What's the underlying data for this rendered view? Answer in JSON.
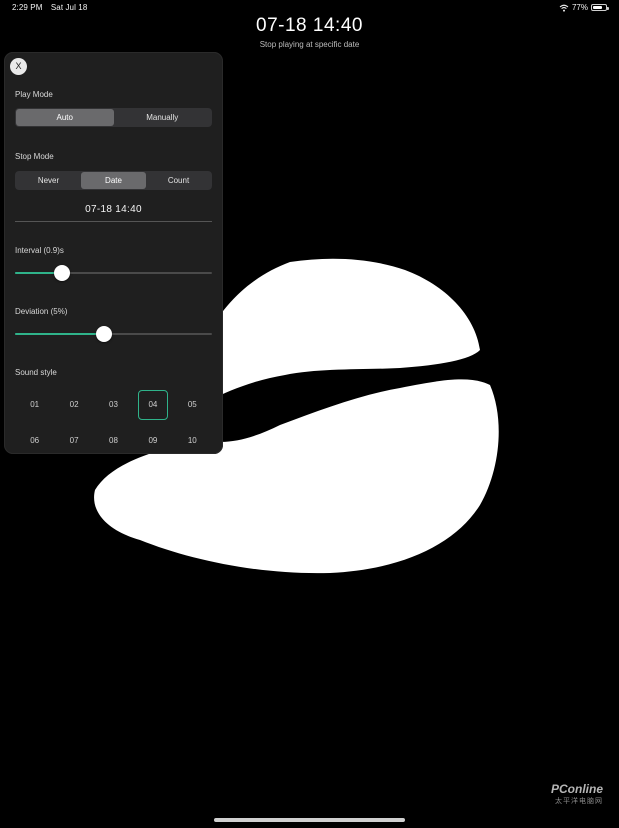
{
  "status_bar": {
    "time": "2:29 PM",
    "date": "Sat Jul 18",
    "battery_text": "77%",
    "battery_level": 0.77
  },
  "header": {
    "clock": "07-18  14:40",
    "subtitle": "Stop playing at specific date"
  },
  "panel": {
    "close_label": "X",
    "play_mode": {
      "label": "Play Mode",
      "options": [
        "Auto",
        "Manually"
      ],
      "selected": "Auto"
    },
    "stop_mode": {
      "label": "Stop Mode",
      "options": [
        "Never",
        "Date",
        "Count"
      ],
      "selected": "Date",
      "date_value": "07-18  14:40"
    },
    "interval": {
      "label": "Interval (0.9)s",
      "value_fraction": 0.24
    },
    "deviation": {
      "label": "Deviation (5%)",
      "value_fraction": 0.45
    },
    "sound_style": {
      "label": "Sound style",
      "options": [
        "01",
        "02",
        "03",
        "04",
        "05",
        "06",
        "07",
        "08",
        "09",
        "10"
      ],
      "selected": "04"
    }
  },
  "watermark": {
    "line1": "PConline",
    "line2": "太平洋电脑网"
  },
  "colors": {
    "accent": "#2fb38a",
    "background": "#000000",
    "panel": "#1f1f1f"
  },
  "icons": {
    "close": "close-icon",
    "wifi": "wifi-icon",
    "battery": "battery-icon"
  }
}
